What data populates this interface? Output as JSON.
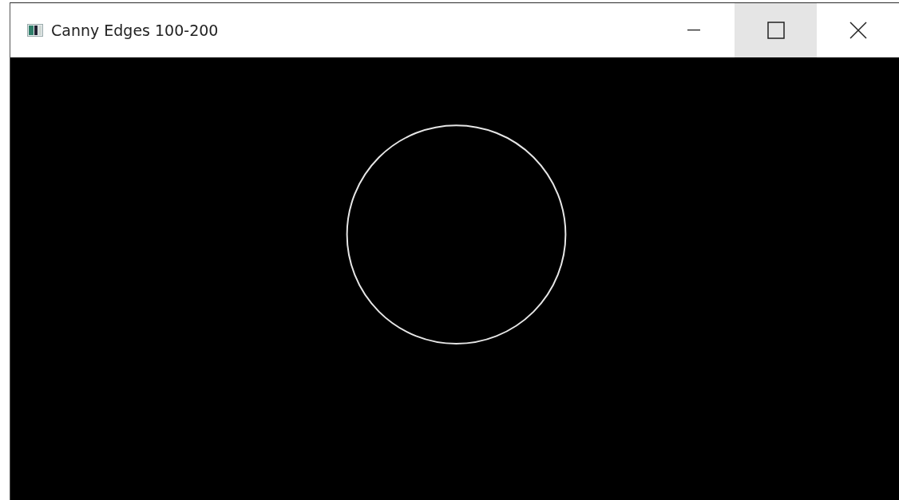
{
  "window": {
    "title": "Canny Edges 100-200"
  },
  "title_buttons": [
    {
      "kind": "minimize",
      "hovered": false
    },
    {
      "kind": "maximize",
      "hovered": true
    },
    {
      "kind": "close",
      "hovered": false
    }
  ]
}
